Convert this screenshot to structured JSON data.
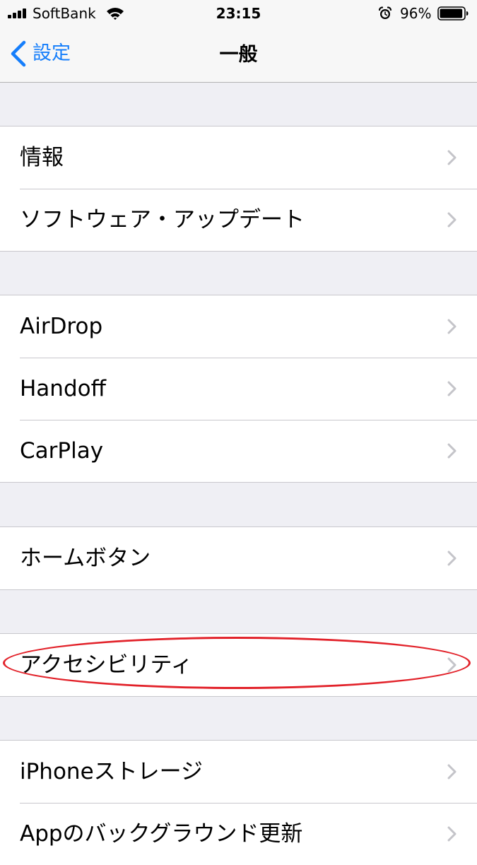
{
  "status_bar": {
    "carrier": "SoftBank",
    "time": "23:15",
    "battery_percent": "96%",
    "battery_level": 0.96,
    "icons": [
      "signal-icon",
      "wifi-icon",
      "alarm-icon",
      "battery-icon"
    ]
  },
  "nav": {
    "back_label": "設定",
    "title": "一般"
  },
  "sections": [
    {
      "items": [
        {
          "label": "情報"
        },
        {
          "label": "ソフトウェア・アップデート"
        }
      ]
    },
    {
      "items": [
        {
          "label": "AirDrop"
        },
        {
          "label": "Handoff"
        },
        {
          "label": "CarPlay"
        }
      ]
    },
    {
      "items": [
        {
          "label": "ホームボタン"
        }
      ]
    },
    {
      "items": [
        {
          "label": "アクセシビリティ"
        }
      ]
    },
    {
      "items": [
        {
          "label": "iPhoneストレージ"
        },
        {
          "label": "Appのバックグラウンド更新"
        }
      ]
    }
  ],
  "colors": {
    "accent": "#157efb",
    "annotation": "#e2222a",
    "background": "#efeff4",
    "separator": "#c8c7cc",
    "chevron": "#c4c4c9"
  }
}
